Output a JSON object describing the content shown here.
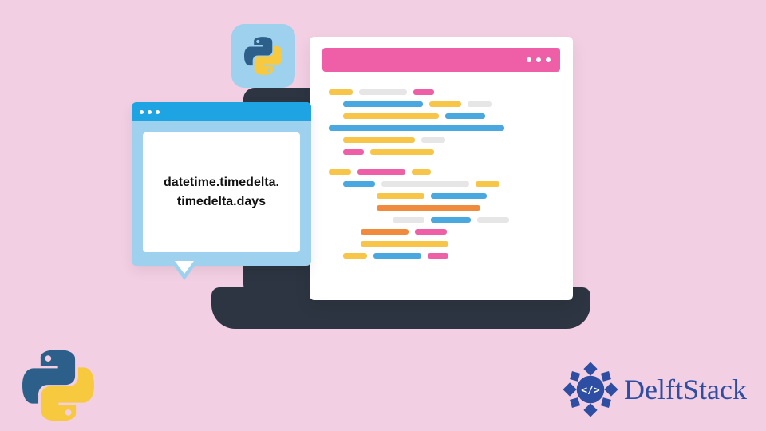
{
  "tooltip": {
    "line1": "datetime.timedelta.",
    "line2": "timedelta.days"
  },
  "brand": {
    "name": "DelftStack"
  },
  "icons": {
    "python_badge": "python-icon",
    "python_corner": "python-icon",
    "brand_mark": "delftstack-icon"
  },
  "editor": {
    "header_color": "#ee5fa7",
    "lang": "python"
  },
  "colors": {
    "background": "#f3cfe3",
    "badge_bg": "#9ed1ed",
    "header_blue": "#1ea4e3",
    "brand_text": "#2d4ea2"
  }
}
